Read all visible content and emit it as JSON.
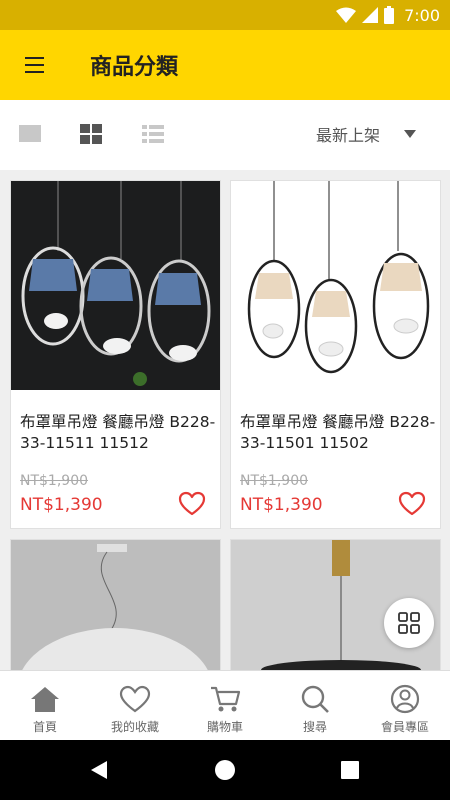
{
  "status_bar": {
    "time": "7:00",
    "icons": [
      "wifi-icon",
      "signal-icon",
      "battery-icon"
    ]
  },
  "app_bar": {
    "title": "商品分類",
    "menu_icon": "hamburger-menu-icon"
  },
  "toolbar": {
    "view_modes": [
      "single-view-icon",
      "grid-view-icon",
      "list-view-icon"
    ],
    "active_view": "grid",
    "sort_label": "最新上架",
    "sort_icon": "dropdown-arrow-icon"
  },
  "products": [
    {
      "name": "布罩單吊燈 餐廳吊燈 B228-33-11511 11512",
      "original_price": "NT$1,900",
      "price": "NT$1,390"
    },
    {
      "name": "布罩單吊燈 餐廳吊燈 B228-33-11501 11502",
      "original_price": "NT$1,900",
      "price": "NT$1,390"
    },
    {
      "name": "",
      "original_price": "",
      "price": ""
    },
    {
      "name": "",
      "original_price": "",
      "price": ""
    }
  ],
  "fab_icon": "grid-apps-icon",
  "bottom_nav": [
    {
      "label": "首頁",
      "icon": "home-icon",
      "active": true
    },
    {
      "label": "我的收藏",
      "icon": "heart-icon"
    },
    {
      "label": "購物車",
      "icon": "cart-icon"
    },
    {
      "label": "搜尋",
      "icon": "search-icon"
    },
    {
      "label": "會員專區",
      "icon": "user-icon"
    }
  ],
  "system_nav": [
    "back-icon",
    "home-circle-icon",
    "recents-icon"
  ],
  "colors": {
    "accent": "#ffd600",
    "status_bar": "#d8b000",
    "price": "#e53935",
    "heart": "#e53935"
  }
}
